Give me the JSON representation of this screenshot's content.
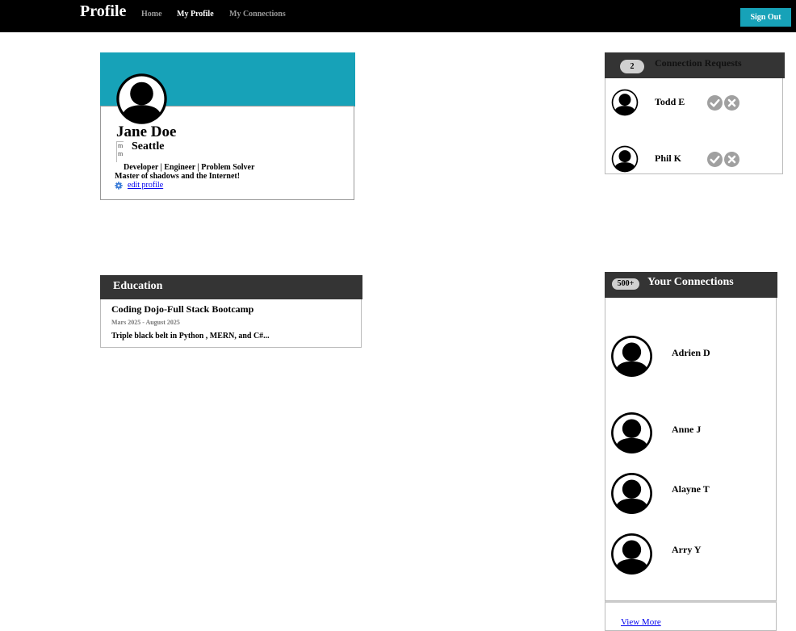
{
  "nav": {
    "brand": "Profile",
    "links": [
      "Home",
      "My Profile",
      "My Connections"
    ],
    "active": "My Profile",
    "sign_out": "Sign Out"
  },
  "colors": {
    "accent": "#17a2b8",
    "header_dark": "#343434",
    "action_gray": "#a0a0a0"
  },
  "profile": {
    "name": "Jane Doe",
    "location_icon_alt": "m m",
    "location": "Seattle",
    "headline": "Developer | Engineer | Problem Solver",
    "bio": "Master of shadows and the Internet!",
    "edit_label": "edit profile",
    "edit_icon": "gear-icon",
    "avatar_icon": "user-avatar-icon"
  },
  "requests": {
    "count": "2",
    "title": "Connection Requests",
    "items": [
      {
        "name": "Todd E"
      },
      {
        "name": "Phil K"
      }
    ],
    "accept_icon": "check-circle-icon",
    "decline_icon": "x-circle-icon"
  },
  "education": {
    "title": "Education",
    "school": "Coding Dojo-Full Stack Bootcamp",
    "dates": "Mars 2025 - August 2025",
    "description": "Triple black belt in Python , MERN, and C#..."
  },
  "connections": {
    "count": "500+",
    "title": "Your Connections",
    "items": [
      {
        "name": "Adrien D"
      },
      {
        "name": "Anne J"
      },
      {
        "name": "Alayne T"
      },
      {
        "name": "Arry Y"
      }
    ],
    "view_more": "View More"
  }
}
